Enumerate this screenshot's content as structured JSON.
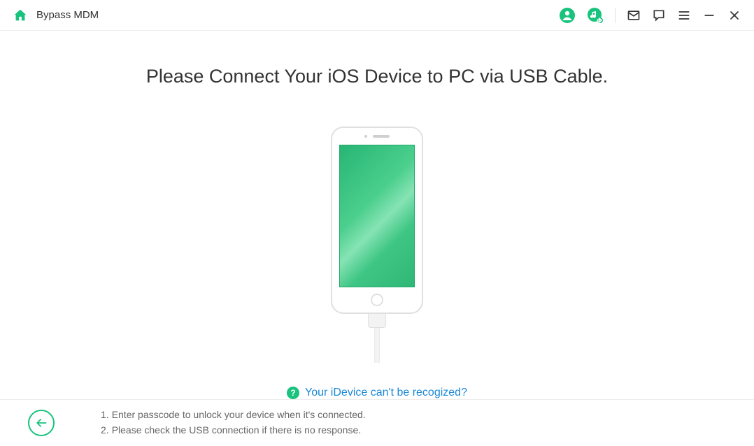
{
  "header": {
    "title": "Bypass MDM"
  },
  "main": {
    "title": "Please Connect Your iOS Device to PC via USB Cable.",
    "help_link": "Your iDevice can't be recogized?"
  },
  "footer": {
    "instructions": [
      {
        "num": "1.",
        "text": "Enter passcode to unlock your device when it's connected."
      },
      {
        "num": "2.",
        "text": "Please check the USB connection if there is no response."
      }
    ]
  }
}
